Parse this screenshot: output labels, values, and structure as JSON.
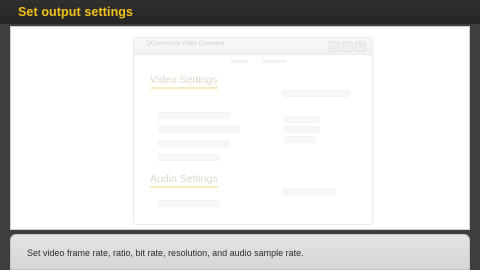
{
  "header": {
    "title": "Set output settings"
  },
  "app": {
    "window_title": "QCommerce Video Converter",
    "window_buttons": [
      "_",
      "□",
      "×"
    ],
    "tabs": [
      "General",
      "Conversion"
    ],
    "video_section": "Video Settings",
    "audio_section": "Audio Settings"
  },
  "caption": {
    "text": "Set video frame rate, ratio, bit rate, resolution, and audio sample rate."
  }
}
